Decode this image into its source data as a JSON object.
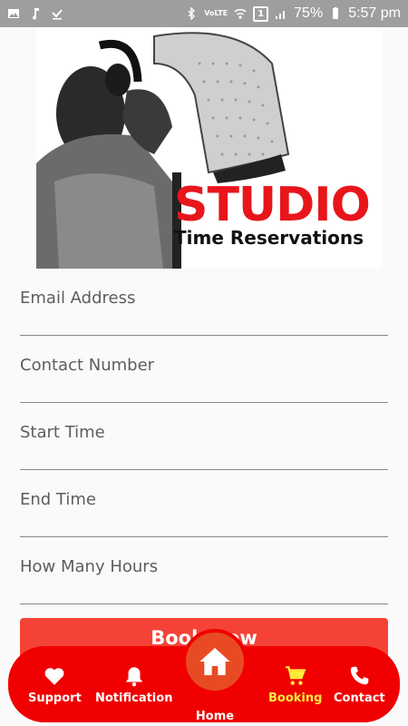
{
  "status_bar": {
    "lte_label": "VoLTE",
    "sim_label": "1",
    "battery": "75%",
    "time": "5:57 pm"
  },
  "banner": {
    "title": "STUDIO",
    "subtitle": "Time Reservations"
  },
  "form": {
    "fields": [
      {
        "placeholder": "Email Address",
        "value": ""
      },
      {
        "placeholder": "Contact Number",
        "value": ""
      },
      {
        "placeholder": "Start Time",
        "value": ""
      },
      {
        "placeholder": "End Time",
        "value": ""
      },
      {
        "placeholder": "How Many Hours",
        "value": ""
      }
    ],
    "submit_label": "Book Now"
  },
  "bottom_nav": {
    "items": [
      {
        "label": "Support",
        "icon": "heart-icon"
      },
      {
        "label": "Notification",
        "icon": "bell-icon"
      },
      {
        "label": "Home",
        "icon": "home-icon"
      },
      {
        "label": "Booking",
        "icon": "cart-icon",
        "active": true
      },
      {
        "label": "Contact",
        "icon": "phone-icon"
      }
    ],
    "active_color": "#ffeb3b",
    "bar_color": "#f00000"
  }
}
